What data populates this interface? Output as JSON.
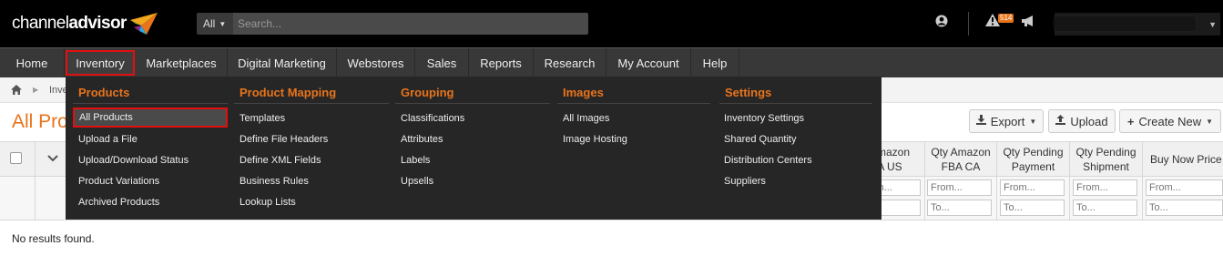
{
  "app": {
    "brand_regular": "channel",
    "brand_bold": "advisor"
  },
  "search": {
    "scope": "All",
    "placeholder": "Search..."
  },
  "alerts": {
    "badge": "514"
  },
  "nav": {
    "items": [
      "Home",
      "Inventory",
      "Marketplaces",
      "Digital Marketing",
      "Webstores",
      "Sales",
      "Reports",
      "Research",
      "My Account",
      "Help"
    ],
    "active": "Inventory"
  },
  "breadcrumb": {
    "crumb": "Inve"
  },
  "page": {
    "title": "All Pro"
  },
  "actions": {
    "export": "Export",
    "upload": "Upload",
    "create": "Create New"
  },
  "grid": {
    "columns": [
      {
        "line1": "Amazon",
        "line2": "A US"
      },
      {
        "line1": "Qty Amazon",
        "line2": "FBA CA"
      },
      {
        "line1": "Qty Pending",
        "line2": "Payment"
      },
      {
        "line1": "Qty Pending",
        "line2": "Shipment"
      },
      {
        "line1": "Buy Now Price",
        "line2": ""
      }
    ],
    "filter_from": "From...",
    "filter_to": "To...",
    "empty_message": "No results found."
  },
  "menu": {
    "sections": [
      {
        "heading": "Products",
        "items": [
          "All Products",
          "Upload a File",
          "Upload/Download Status",
          "Product Variations",
          "Archived Products"
        ]
      },
      {
        "heading": "Product Mapping",
        "items": [
          "Templates",
          "Define File Headers",
          "Define XML Fields",
          "Business Rules",
          "Lookup Lists"
        ]
      },
      {
        "heading": "Grouping",
        "items": [
          "Classifications",
          "Attributes",
          "Labels",
          "Upsells"
        ]
      },
      {
        "heading": "Images",
        "items": [
          "All Images",
          "Image Hosting"
        ]
      },
      {
        "heading": "Settings",
        "items": [
          "Inventory Settings",
          "Shared Quantity",
          "Distribution Centers",
          "Suppliers"
        ]
      }
    ],
    "highlighted": "All Products"
  },
  "colors": {
    "accent": "#e8741c",
    "highlight_border": "#e01010",
    "topbar": "#000000",
    "navbar": "#383838",
    "menu_bg": "#262626"
  },
  "icons": [
    "logo-icon",
    "chevron-down-icon",
    "user-icon",
    "alert-icon",
    "megaphone-icon",
    "home-icon",
    "download-icon",
    "upload-icon",
    "plus-icon"
  ]
}
